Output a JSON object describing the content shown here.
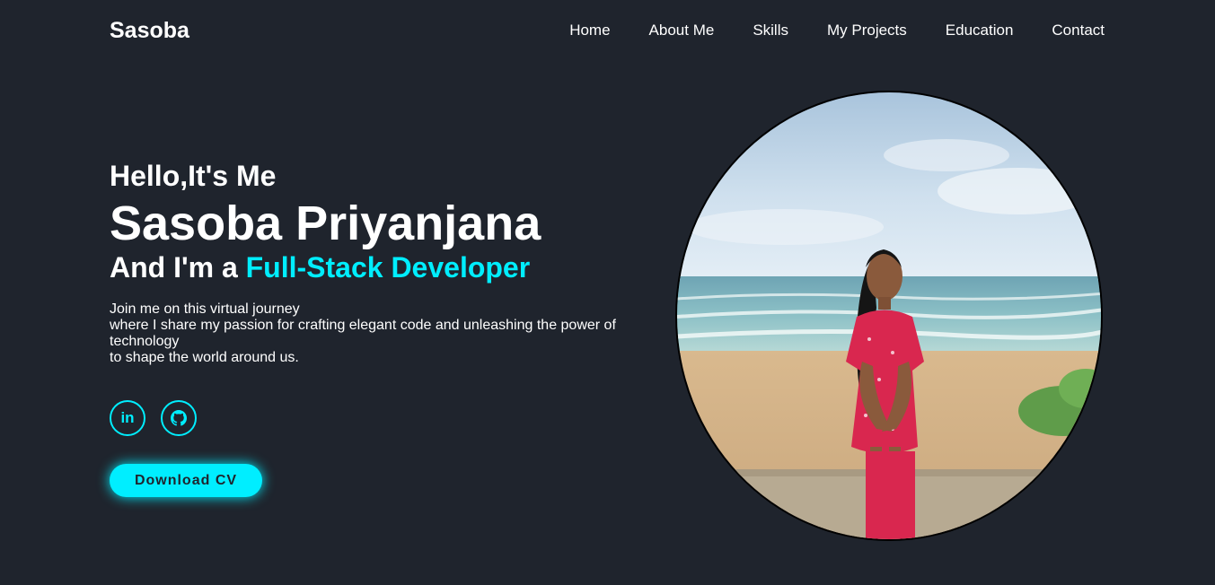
{
  "header": {
    "logo": "Sasoba",
    "nav": [
      "Home",
      "About Me",
      "Skills",
      "My Projects",
      "Education",
      "Contact"
    ]
  },
  "hero": {
    "greeting": "Hello,It's Me",
    "name": "Sasoba Priyanjana",
    "role_prefix": "And I'm a ",
    "role_highlight": "Full-Stack Developer",
    "intro_lines": [
      "Join me on this virtual journey",
      "where I share my passion for crafting elegant code and unleashing the power of technology",
      "to shape the world around us."
    ],
    "socials": [
      {
        "icon": "linkedin-icon",
        "glyph": "in"
      },
      {
        "icon": "github-icon",
        "glyph": "github"
      }
    ],
    "cv_button": "Download CV"
  },
  "colors": {
    "background": "#1f242d",
    "accent": "#00eeff",
    "text": "#ffffff"
  }
}
